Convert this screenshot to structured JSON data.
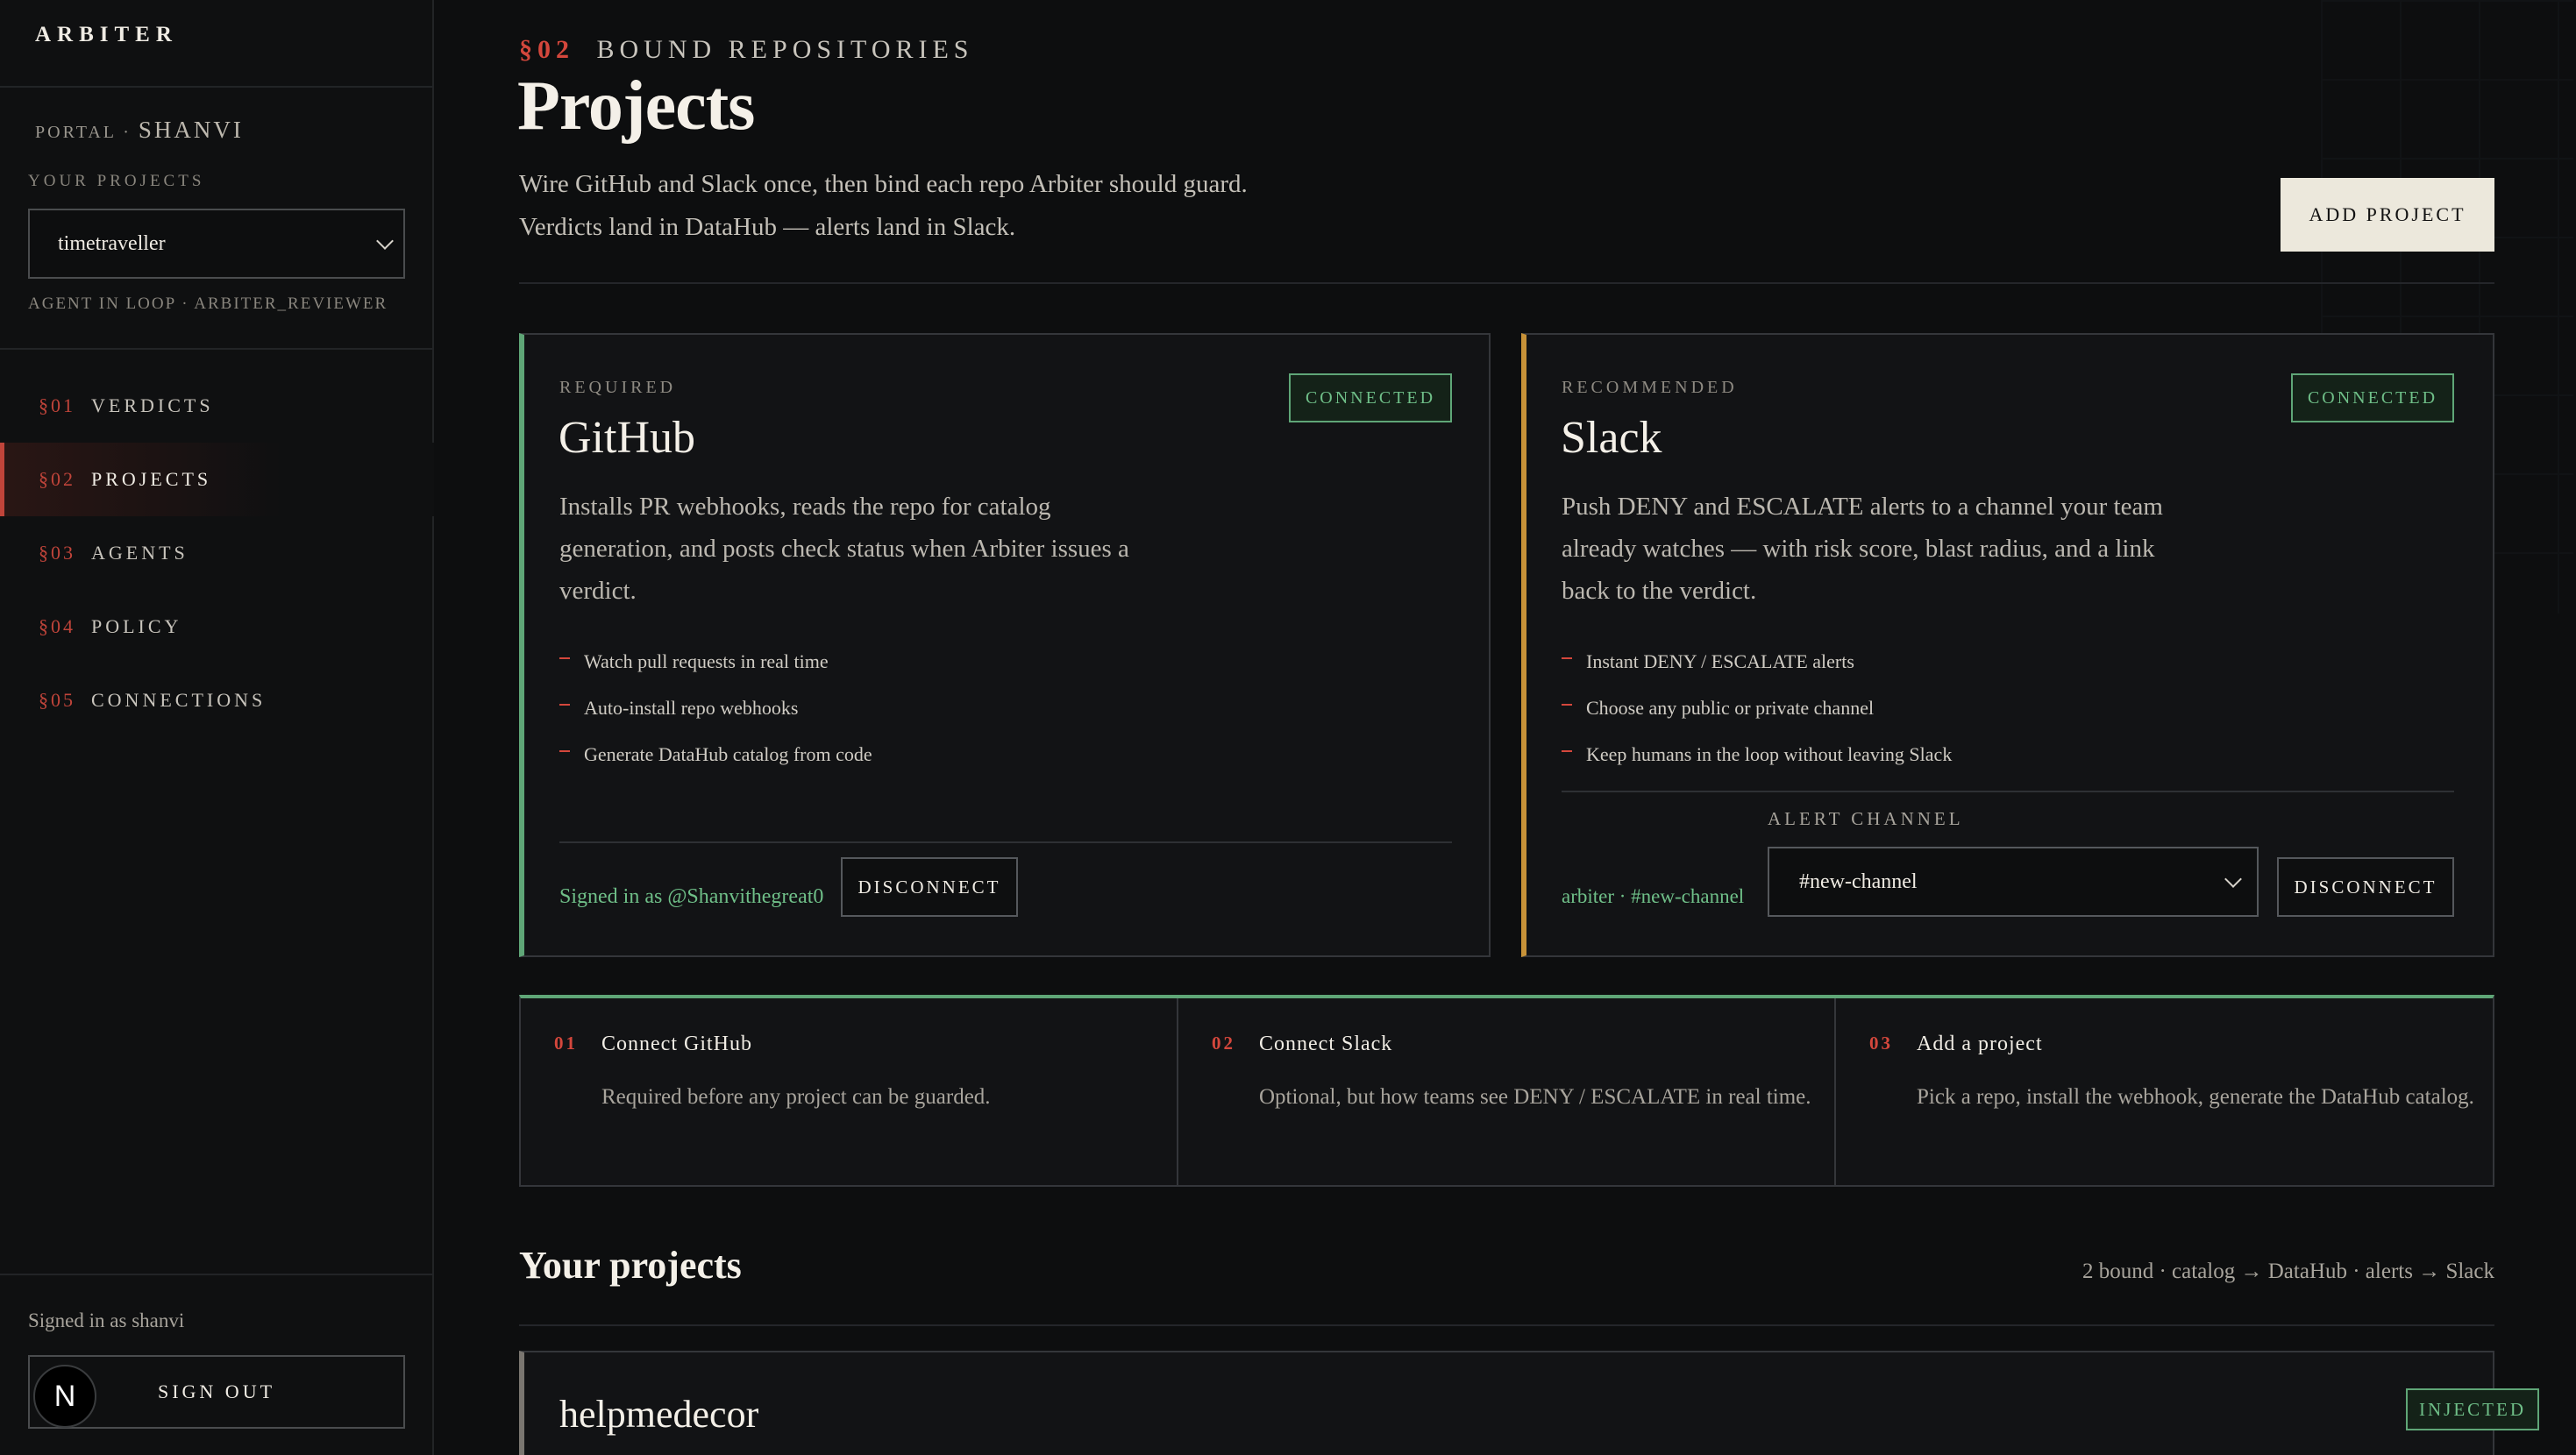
{
  "sidebar": {
    "brand": "ARBITER",
    "portal_label": "PORTAL ·",
    "portal_user": "SHANVI",
    "your_projects_label": "YOUR PROJECTS",
    "selected_project": "timetraveller",
    "agent_in_loop": "AGENT IN LOOP · ARBITER_REVIEWER",
    "nav": [
      {
        "sec": "§01",
        "label": "VERDICTS"
      },
      {
        "sec": "§02",
        "label": "PROJECTS",
        "active": true
      },
      {
        "sec": "§03",
        "label": "AGENTS"
      },
      {
        "sec": "§04",
        "label": "POLICY"
      },
      {
        "sec": "§05",
        "label": "CONNECTIONS"
      }
    ],
    "signed_in": "Signed in as shanvi",
    "sign_out": "SIGN OUT",
    "n_badge": "N"
  },
  "header": {
    "section": "§02",
    "kicker": "BOUND REPOSITORIES",
    "title": "Projects",
    "intro_line1": "Wire GitHub and Slack once, then bind each repo Arbiter should guard.",
    "intro_line2": "Verdicts land in DataHub — alerts land in Slack.",
    "add_project": "ADD PROJECT"
  },
  "github": {
    "tier": "REQUIRED",
    "title": "GitHub",
    "status": "CONNECTED",
    "desc_line1": "Installs PR webhooks, reads the repo for catalog",
    "desc_line2": "generation, and posts check status when Arbiter issues a",
    "desc_line3": "verdict.",
    "bullets": [
      "Watch pull requests in real time",
      "Auto-install repo webhooks",
      "Generate DataHub catalog from code"
    ],
    "signed_in": "Signed in as @Shanvithegreat0",
    "disconnect": "DISCONNECT"
  },
  "slack": {
    "tier": "RECOMMENDED",
    "title": "Slack",
    "status": "CONNECTED",
    "desc_line1": "Push DENY and ESCALATE alerts to a channel your team",
    "desc_line2": "already watches — with risk score, blast radius, and a link",
    "desc_line3": "back to the verdict.",
    "bullets": [
      "Instant DENY / ESCALATE alerts",
      "Choose any public or private channel",
      "Keep humans in the loop without leaving Slack"
    ],
    "route": "arbiter · #new-channel",
    "alert_channel_label": "ALERT CHANNEL",
    "alert_channel": "#new-channel",
    "disconnect": "DISCONNECT"
  },
  "steps": [
    {
      "num": "01",
      "title": "Connect GitHub",
      "desc": "Required before any project can be guarded."
    },
    {
      "num": "02",
      "title": "Connect Slack",
      "desc": "Optional, but how teams see DENY / ESCALATE in real time."
    },
    {
      "num": "03",
      "title": "Add a project",
      "desc": "Pick a repo, install the webhook, generate the DataHub catalog."
    }
  ],
  "your_projects": {
    "title": "Your projects",
    "meta": "2 bound · catalog → DataHub · alerts → Slack",
    "projects": [
      {
        "name": "helpmedecor",
        "status": "INJECTED"
      }
    ]
  },
  "colors": {
    "accent_red": "#d4473c",
    "connected_green": "#5fa677",
    "slack_amber": "#c79238",
    "background": "#0d0e0f"
  }
}
